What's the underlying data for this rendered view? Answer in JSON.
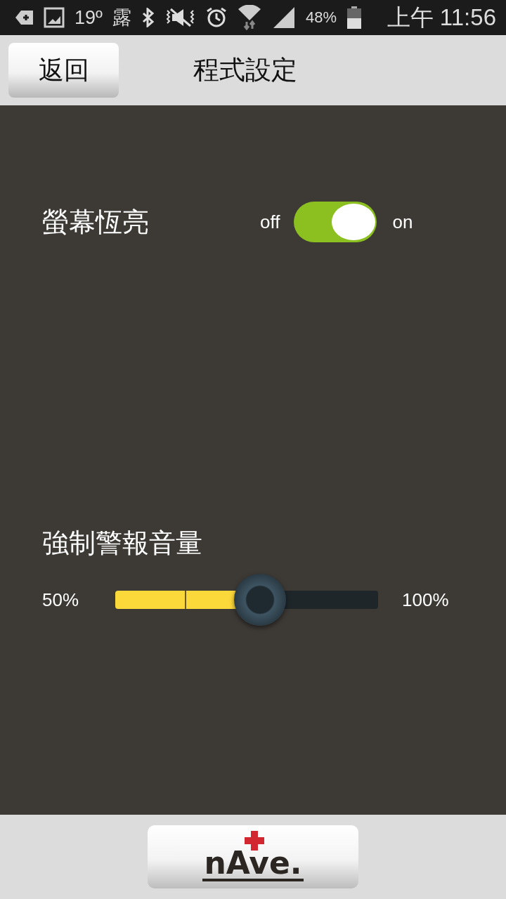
{
  "status_bar": {
    "temperature": "19º",
    "weather": "露",
    "battery": "48%",
    "time": "上午 11:56"
  },
  "header": {
    "back_button": "返回",
    "title": "程式設定"
  },
  "settings": [
    {
      "kind": "switch",
      "label": "螢幕恆亮",
      "off_label": "off",
      "on_label": "on",
      "on": true
    },
    {
      "kind": "slider",
      "label": "強制警報音量",
      "min_label": "50%",
      "max_label": "100%",
      "level": 0.55
    }
  ],
  "footer": {
    "logo": "nAve."
  }
}
